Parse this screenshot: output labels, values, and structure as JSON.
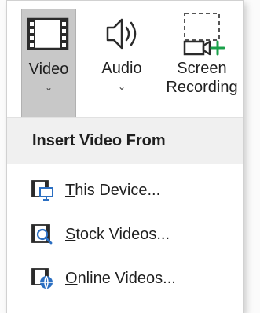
{
  "ribbon": {
    "video": {
      "label": "Video",
      "chevron": "⌄",
      "icon": "film-strip-icon"
    },
    "audio": {
      "label": "Audio",
      "chevron": "⌄",
      "icon": "speaker-icon"
    },
    "screen": {
      "label_line1": "Screen",
      "label_line2": "Recording",
      "icon": "screen-recording-icon"
    }
  },
  "menu": {
    "header": "Insert Video From",
    "items": [
      {
        "label_access": "T",
        "label_rest": "his Device...",
        "icon": "device-video-icon"
      },
      {
        "label_access": "S",
        "label_rest": "tock Videos...",
        "icon": "stock-videos-icon"
      },
      {
        "label_access": "O",
        "label_rest": "nline Videos...",
        "icon": "online-videos-icon"
      }
    ]
  },
  "colors": {
    "accent_green": "#1aa14a",
    "accent_blue": "#2b6fc2",
    "selected_bg": "#c8c8c8"
  }
}
